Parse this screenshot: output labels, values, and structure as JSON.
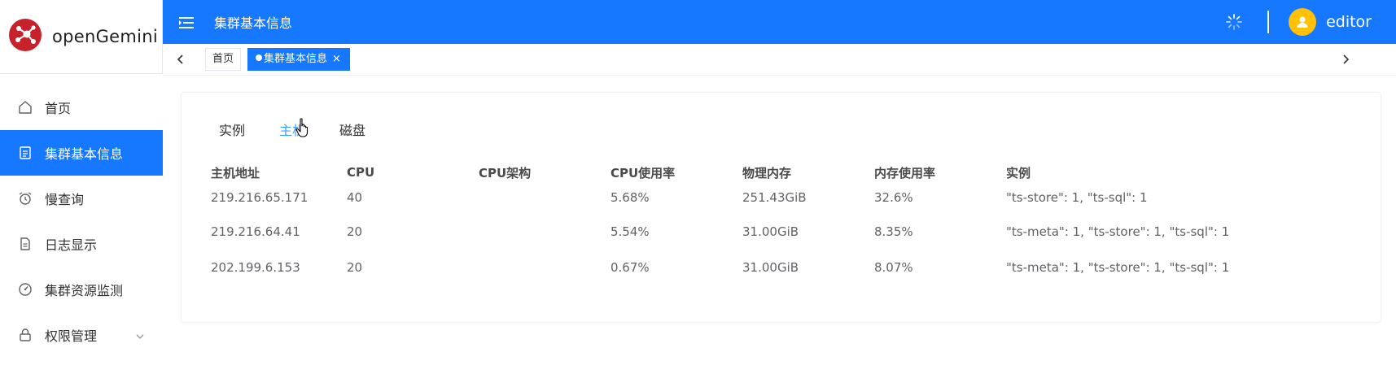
{
  "brand": {
    "name": "openGemini",
    "logo_color": "#c7222b"
  },
  "header": {
    "title": "集群基本信息",
    "username": "editor",
    "bg": "#1677ff",
    "avatar_color": "#ffc107"
  },
  "tags": {
    "home_label": "首页",
    "active_label": "集群基本信息",
    "close_glyph": "×"
  },
  "sidebar": {
    "items": [
      {
        "label": "首页",
        "icon": "home-icon",
        "active": false
      },
      {
        "label": "集群基本信息",
        "icon": "document-icon",
        "active": true
      },
      {
        "label": "慢查询",
        "icon": "alarm-clock-icon",
        "active": false
      },
      {
        "label": "日志显示",
        "icon": "file-icon",
        "active": false
      },
      {
        "label": "集群资源监测",
        "icon": "gauge-icon",
        "active": false
      },
      {
        "label": "权限管理",
        "icon": "lock-icon",
        "active": false,
        "expandable": true
      }
    ]
  },
  "tabs": [
    {
      "label": "实例",
      "active": false
    },
    {
      "label": "主机",
      "active": true
    },
    {
      "label": "磁盘",
      "active": false
    }
  ],
  "table": {
    "columns": [
      "主机地址",
      "CPU",
      "CPU架构",
      "CPU使用率",
      "物理内存",
      "内存使用率",
      "实例"
    ],
    "rows": [
      [
        "219.216.65.171",
        "40",
        "",
        "5.68%",
        "251.43GiB",
        "32.6%",
        "\"ts-store\": 1, \"ts-sql\": 1"
      ],
      [
        "219.216.64.41",
        "20",
        "",
        "5.54%",
        "31.00GiB",
        "8.35%",
        "\"ts-meta\": 1, \"ts-store\": 1, \"ts-sql\": 1"
      ],
      [
        "202.199.6.153",
        "20",
        "",
        "0.67%",
        "31.00GiB",
        "8.07%",
        "\"ts-meta\": 1, \"ts-store\": 1, \"ts-sql\": 1"
      ]
    ]
  }
}
